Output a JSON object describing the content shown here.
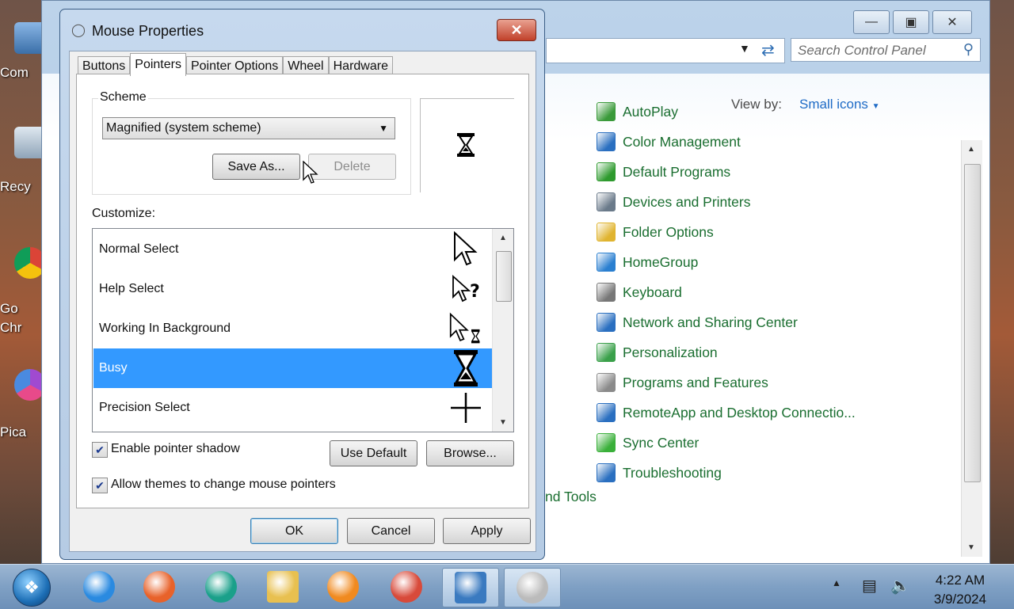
{
  "desktop": {
    "icons": [
      {
        "label": "Com"
      },
      {
        "label": "Recy"
      },
      {
        "label": "Go\nChr"
      },
      {
        "label": "Pica"
      }
    ]
  },
  "control_panel": {
    "search_placeholder": "Search Control Panel",
    "view_by_label": "View by:",
    "view_by_value": "Small icons",
    "partial_item": "nd Tools",
    "items": [
      {
        "label": "AutoPlay",
        "icon": "autoplay-icon",
        "color": "#3a9a3a"
      },
      {
        "label": "Color Management",
        "icon": "color-management-icon",
        "color": "#2a6fc0"
      },
      {
        "label": "Default Programs",
        "icon": "default-programs-icon",
        "color": "#2e9a2e"
      },
      {
        "label": "Devices and Printers",
        "icon": "devices-printers-icon",
        "color": "#6a7a8a"
      },
      {
        "label": "Folder Options",
        "icon": "folder-options-icon",
        "color": "#e0b430"
      },
      {
        "label": "HomeGroup",
        "icon": "homegroup-icon",
        "color": "#2a7fd0"
      },
      {
        "label": "Keyboard",
        "icon": "keyboard-icon",
        "color": "#777777"
      },
      {
        "label": "Network and Sharing Center",
        "icon": "network-icon",
        "color": "#2a6fc0"
      },
      {
        "label": "Personalization",
        "icon": "personalization-icon",
        "color": "#3aa04a"
      },
      {
        "label": "Programs and Features",
        "icon": "programs-features-icon",
        "color": "#8a8a8a"
      },
      {
        "label": "RemoteApp and Desktop Connectio...",
        "icon": "remoteapp-icon",
        "color": "#2a6fc0"
      },
      {
        "label": "Sync Center",
        "icon": "sync-center-icon",
        "color": "#3ab03a"
      },
      {
        "label": "Troubleshooting",
        "icon": "troubleshooting-icon",
        "color": "#2a6fc0"
      }
    ]
  },
  "dialog": {
    "title": "Mouse Properties",
    "close_glyph": "✕",
    "tabs": [
      "Buttons",
      "Pointers",
      "Pointer Options",
      "Wheel",
      "Hardware"
    ],
    "active_tab": "Pointers",
    "scheme_label": "Scheme",
    "scheme_value": "Magnified (system scheme)",
    "save_as": "Save As...",
    "delete": "Delete",
    "customize_label": "Customize:",
    "pointers": [
      {
        "label": "Normal Select",
        "icon": "arrow-cursor-icon"
      },
      {
        "label": "Help Select",
        "icon": "help-cursor-icon"
      },
      {
        "label": "Working In Background",
        "icon": "working-cursor-icon"
      },
      {
        "label": "Busy",
        "icon": "hourglass-cursor-icon",
        "selected": true
      },
      {
        "label": "Precision Select",
        "icon": "crosshair-cursor-icon"
      }
    ],
    "enable_shadow_label": "Enable pointer shadow",
    "enable_shadow_checked": true,
    "allow_themes_label": "Allow themes to change mouse pointers",
    "allow_themes_checked": true,
    "use_default": "Use Default",
    "browse": "Browse...",
    "ok": "OK",
    "cancel": "Cancel",
    "apply": "Apply"
  },
  "taskbar": {
    "apps": [
      {
        "name": "internet-explorer-icon",
        "color": "#2a8ae0"
      },
      {
        "name": "firefox-icon",
        "color": "#e8622a"
      },
      {
        "name": "app-teal-icon",
        "color": "#1aa08a"
      },
      {
        "name": "file-explorer-icon",
        "color": "#e8c050"
      },
      {
        "name": "media-player-icon",
        "color": "#f08a20"
      },
      {
        "name": "chrome-icon",
        "color": "#d84a3a"
      },
      {
        "name": "control-panel-icon",
        "color": "#3a7ac0"
      },
      {
        "name": "mouse-icon",
        "color": "#bbbbbb"
      }
    ],
    "time": "4:22 AM",
    "date": "3/9/2024"
  }
}
